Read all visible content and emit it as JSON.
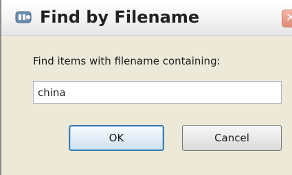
{
  "window": {
    "title": "Find by Filename",
    "app_icon": "app-icon",
    "close_icon": "close-icon",
    "close_glyph": "✕"
  },
  "form": {
    "prompt": "Find items with filename containing:",
    "filename_value": "china"
  },
  "buttons": {
    "ok_label": "OK",
    "cancel_label": "Cancel"
  },
  "colors": {
    "dialog_background": "#ece9d8",
    "default_button_border": "#3c7fb1",
    "close_button": "#e08a76"
  }
}
